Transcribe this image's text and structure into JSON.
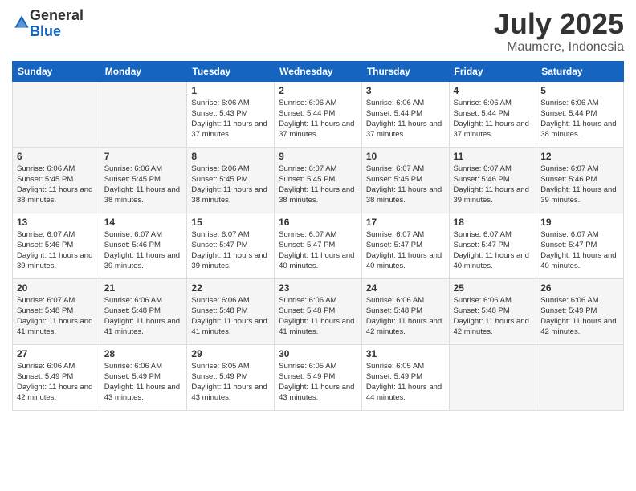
{
  "logo": {
    "general": "General",
    "blue": "Blue"
  },
  "title": "July 2025",
  "location": "Maumere, Indonesia",
  "days_of_week": [
    "Sunday",
    "Monday",
    "Tuesday",
    "Wednesday",
    "Thursday",
    "Friday",
    "Saturday"
  ],
  "weeks": [
    [
      {
        "day": "",
        "content": ""
      },
      {
        "day": "",
        "content": ""
      },
      {
        "day": "1",
        "content": "Sunrise: 6:06 AM\nSunset: 5:43 PM\nDaylight: 11 hours and 37 minutes."
      },
      {
        "day": "2",
        "content": "Sunrise: 6:06 AM\nSunset: 5:44 PM\nDaylight: 11 hours and 37 minutes."
      },
      {
        "day": "3",
        "content": "Sunrise: 6:06 AM\nSunset: 5:44 PM\nDaylight: 11 hours and 37 minutes."
      },
      {
        "day": "4",
        "content": "Sunrise: 6:06 AM\nSunset: 5:44 PM\nDaylight: 11 hours and 37 minutes."
      },
      {
        "day": "5",
        "content": "Sunrise: 6:06 AM\nSunset: 5:44 PM\nDaylight: 11 hours and 38 minutes."
      }
    ],
    [
      {
        "day": "6",
        "content": "Sunrise: 6:06 AM\nSunset: 5:45 PM\nDaylight: 11 hours and 38 minutes."
      },
      {
        "day": "7",
        "content": "Sunrise: 6:06 AM\nSunset: 5:45 PM\nDaylight: 11 hours and 38 minutes."
      },
      {
        "day": "8",
        "content": "Sunrise: 6:06 AM\nSunset: 5:45 PM\nDaylight: 11 hours and 38 minutes."
      },
      {
        "day": "9",
        "content": "Sunrise: 6:07 AM\nSunset: 5:45 PM\nDaylight: 11 hours and 38 minutes."
      },
      {
        "day": "10",
        "content": "Sunrise: 6:07 AM\nSunset: 5:45 PM\nDaylight: 11 hours and 38 minutes."
      },
      {
        "day": "11",
        "content": "Sunrise: 6:07 AM\nSunset: 5:46 PM\nDaylight: 11 hours and 39 minutes."
      },
      {
        "day": "12",
        "content": "Sunrise: 6:07 AM\nSunset: 5:46 PM\nDaylight: 11 hours and 39 minutes."
      }
    ],
    [
      {
        "day": "13",
        "content": "Sunrise: 6:07 AM\nSunset: 5:46 PM\nDaylight: 11 hours and 39 minutes."
      },
      {
        "day": "14",
        "content": "Sunrise: 6:07 AM\nSunset: 5:46 PM\nDaylight: 11 hours and 39 minutes."
      },
      {
        "day": "15",
        "content": "Sunrise: 6:07 AM\nSunset: 5:47 PM\nDaylight: 11 hours and 39 minutes."
      },
      {
        "day": "16",
        "content": "Sunrise: 6:07 AM\nSunset: 5:47 PM\nDaylight: 11 hours and 40 minutes."
      },
      {
        "day": "17",
        "content": "Sunrise: 6:07 AM\nSunset: 5:47 PM\nDaylight: 11 hours and 40 minutes."
      },
      {
        "day": "18",
        "content": "Sunrise: 6:07 AM\nSunset: 5:47 PM\nDaylight: 11 hours and 40 minutes."
      },
      {
        "day": "19",
        "content": "Sunrise: 6:07 AM\nSunset: 5:47 PM\nDaylight: 11 hours and 40 minutes."
      }
    ],
    [
      {
        "day": "20",
        "content": "Sunrise: 6:07 AM\nSunset: 5:48 PM\nDaylight: 11 hours and 41 minutes."
      },
      {
        "day": "21",
        "content": "Sunrise: 6:06 AM\nSunset: 5:48 PM\nDaylight: 11 hours and 41 minutes."
      },
      {
        "day": "22",
        "content": "Sunrise: 6:06 AM\nSunset: 5:48 PM\nDaylight: 11 hours and 41 minutes."
      },
      {
        "day": "23",
        "content": "Sunrise: 6:06 AM\nSunset: 5:48 PM\nDaylight: 11 hours and 41 minutes."
      },
      {
        "day": "24",
        "content": "Sunrise: 6:06 AM\nSunset: 5:48 PM\nDaylight: 11 hours and 42 minutes."
      },
      {
        "day": "25",
        "content": "Sunrise: 6:06 AM\nSunset: 5:48 PM\nDaylight: 11 hours and 42 minutes."
      },
      {
        "day": "26",
        "content": "Sunrise: 6:06 AM\nSunset: 5:49 PM\nDaylight: 11 hours and 42 minutes."
      }
    ],
    [
      {
        "day": "27",
        "content": "Sunrise: 6:06 AM\nSunset: 5:49 PM\nDaylight: 11 hours and 42 minutes."
      },
      {
        "day": "28",
        "content": "Sunrise: 6:06 AM\nSunset: 5:49 PM\nDaylight: 11 hours and 43 minutes."
      },
      {
        "day": "29",
        "content": "Sunrise: 6:05 AM\nSunset: 5:49 PM\nDaylight: 11 hours and 43 minutes."
      },
      {
        "day": "30",
        "content": "Sunrise: 6:05 AM\nSunset: 5:49 PM\nDaylight: 11 hours and 43 minutes."
      },
      {
        "day": "31",
        "content": "Sunrise: 6:05 AM\nSunset: 5:49 PM\nDaylight: 11 hours and 44 minutes."
      },
      {
        "day": "",
        "content": ""
      },
      {
        "day": "",
        "content": ""
      }
    ]
  ]
}
